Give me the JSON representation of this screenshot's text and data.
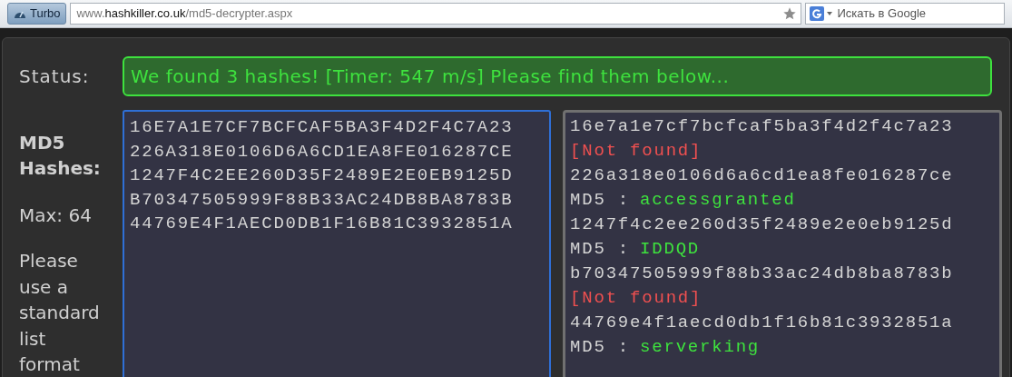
{
  "browser": {
    "turbo_button": "Turbo",
    "url": {
      "prefix": "www.",
      "domain": "hashkiller.co.uk",
      "path": "/md5-decrypter.aspx"
    },
    "search": {
      "placeholder": "Искать в Google"
    }
  },
  "status": {
    "label": "Status:",
    "message": "We found 3 hashes! [Timer: 547 m/s] Please find them below..."
  },
  "sidebar": {
    "title": "MD5 Hashes:",
    "max": "Max: 64",
    "hint": "Please use a standard list format"
  },
  "input": {
    "lines": [
      "16E7A1E7CF7BCFCAF5BA3F4D2F4C7A23",
      "226A318E0106D6A6CD1EA8FE016287CE",
      "1247F4C2EE260D35F2489E2E0EB9125D",
      "B70347505999F88B33AC24DB8BA8783B",
      "44769E4F1AECD0DB1F16B81C3932851A"
    ]
  },
  "results": [
    {
      "hash": "16e7a1e7cf7bcfcaf5ba3f4d2f4c7a23",
      "kind": "not_found",
      "text": "[Not found]"
    },
    {
      "hash": "226a318e0106d6a6cd1ea8fe016287ce",
      "kind": "found",
      "prefix": "MD5 :",
      "value": "accessgranted"
    },
    {
      "hash": "1247f4c2ee260d35f2489e2e0eb9125d",
      "kind": "found",
      "prefix": "MD5 :",
      "value": "IDDQD"
    },
    {
      "hash": "b70347505999f88b33ac24db8ba8783b",
      "kind": "not_found",
      "text": "[Not found]"
    },
    {
      "hash": "44769e4f1aecd0db1f16b81c3932851a",
      "kind": "found",
      "prefix": "MD5 :",
      "value": "serverking"
    }
  ]
}
